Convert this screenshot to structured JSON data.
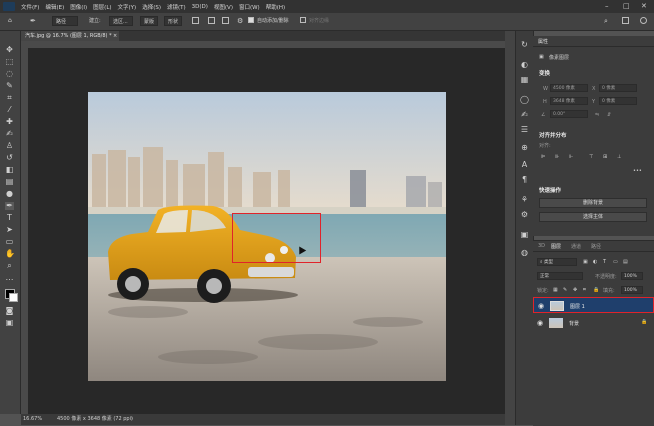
{
  "menu": {
    "items": [
      "文件(F)",
      "编辑(E)",
      "图像(I)",
      "图层(L)",
      "文字(Y)",
      "选择(S)",
      "滤镜(T)",
      "3D(D)",
      "视图(V)",
      "窗口(W)",
      "帮助(H)"
    ],
    "window_controls": [
      "–",
      "□",
      "✕"
    ]
  },
  "options": {
    "mode_value": "路径",
    "build_label": "建立:",
    "selection_label": "选区...",
    "mask_label": "蒙版",
    "shape_label": "形状",
    "auto_add_delete": "自动添加/删除",
    "align_edges": "对齐边缘"
  },
  "document": {
    "tab_title": "汽车.jpg @ 16.7% (图层 1, RGB/8) *",
    "status_zoom": "16.67%",
    "status_info": "4500 像素 x 3648 像素 (72 ppi)"
  },
  "properties": {
    "tabs": [
      "属性"
    ],
    "pixel_layer_label": "像素图层",
    "transform_header": "变换",
    "w_label": "W",
    "h_label": "H",
    "w_value": "4500 像素",
    "h_value": "3648 像素",
    "x_value": "0 像素",
    "y_value": "0 像素",
    "angle_value": "0.00°",
    "align_header": "对齐并分布",
    "align_label": "对齐:",
    "more": "•••",
    "quick_actions_header": "快速操作",
    "remove_bg_button": "删除背景",
    "select_subject_button": "选择主体"
  },
  "layers": {
    "tabs": [
      "3D",
      "图层",
      "通道",
      "路径"
    ],
    "kind_filter": "类型",
    "blend_mode": "正常",
    "opacity_label": "不透明度:",
    "opacity_value": "100%",
    "lock_label": "锁定:",
    "fill_label": "填充:",
    "fill_value": "100%",
    "items": [
      {
        "name": "图层 1",
        "selected": true
      },
      {
        "name": "背景",
        "selected": false
      }
    ]
  }
}
